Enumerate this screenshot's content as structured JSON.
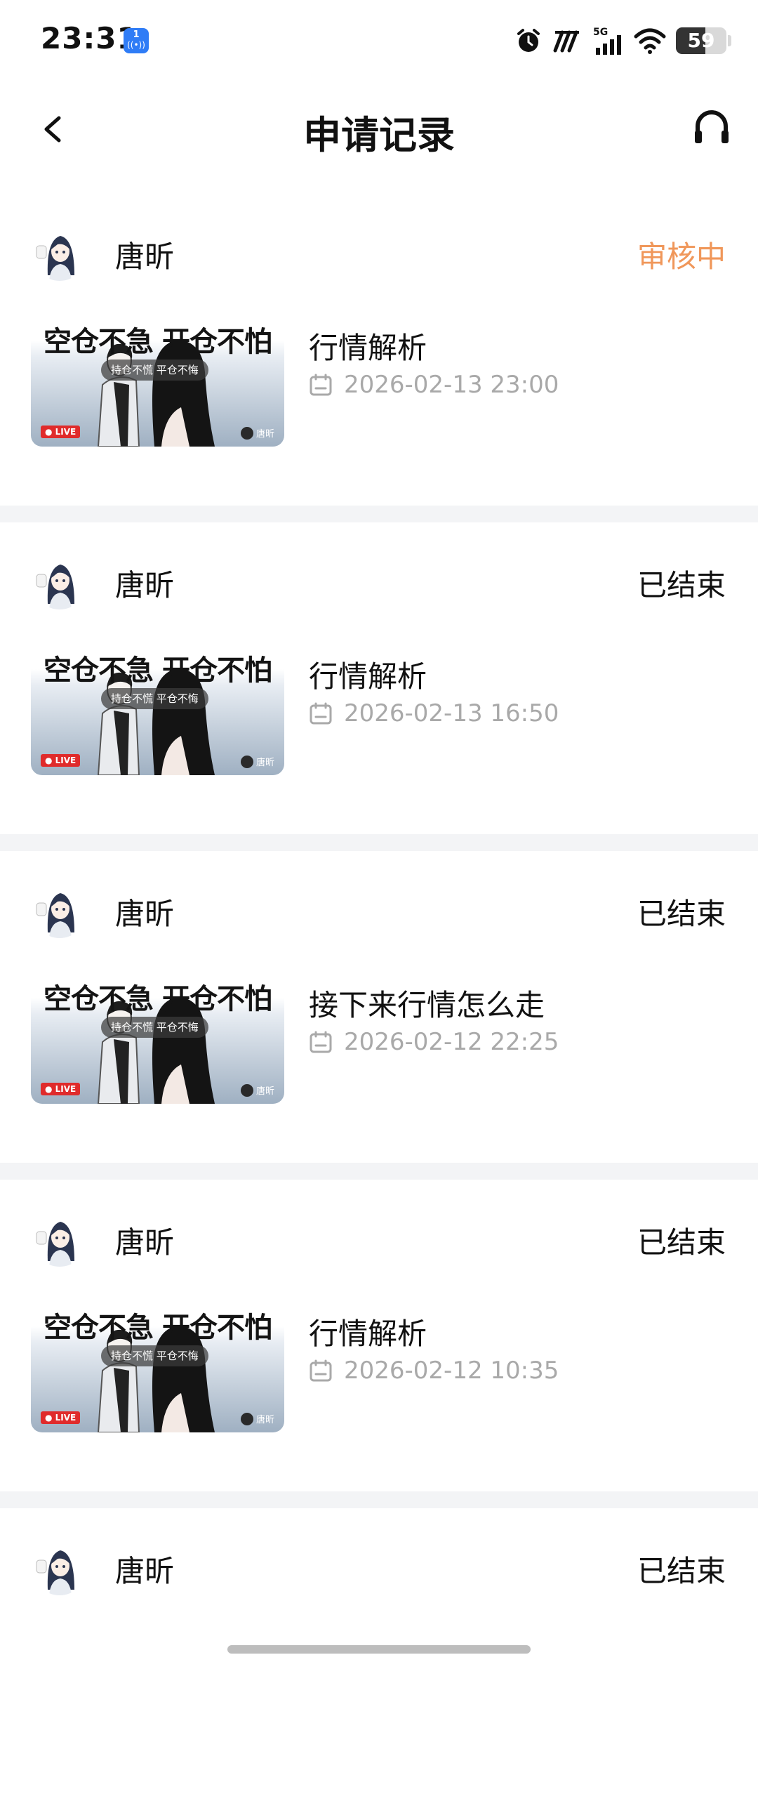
{
  "status_bar": {
    "time": "23:31",
    "notification_badge": "1",
    "battery_level": "59",
    "battery_fraction": 0.59,
    "icons": [
      "alarm-icon",
      "hd-icon",
      "5g-signal-icon",
      "wifi-icon",
      "battery-icon"
    ]
  },
  "header": {
    "title": "申请记录",
    "back_icon": "chevron-left-icon",
    "support_icon": "headset-icon"
  },
  "colors": {
    "pending": "#f0975a",
    "ended": "#111111",
    "meta_gray": "#a9a9a9",
    "divider": "#f3f4f6",
    "live_red": "#e02b2b"
  },
  "cover": {
    "headline": "空仓不急 开仓不怕",
    "subline": "持仓不慌 平仓不悔",
    "live": "LIVE",
    "watermark": "唐昕"
  },
  "records": [
    {
      "host": "唐昕",
      "status": "审核中",
      "title": "行情解析",
      "time": "2026-02-13 23:00"
    },
    {
      "host": "唐昕",
      "status": "已结束",
      "title": "行情解析",
      "time": "2026-02-13 16:50"
    },
    {
      "host": "唐昕",
      "status": "已结束",
      "title": "接下来行情怎么走",
      "time": "2026-02-12 22:25"
    },
    {
      "host": "唐昕",
      "status": "已结束",
      "title": "行情解析",
      "time": "2026-02-12 10:35"
    },
    {
      "host": "唐昕",
      "status": "已结束"
    }
  ]
}
